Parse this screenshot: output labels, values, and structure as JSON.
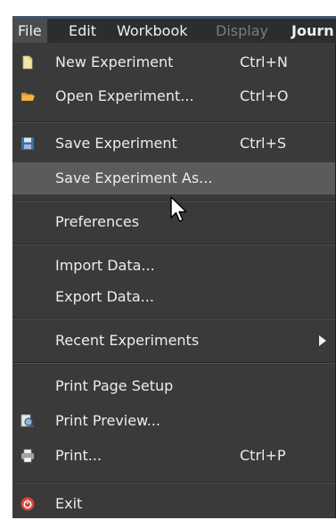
{
  "menubar": {
    "items": [
      {
        "label": "File"
      },
      {
        "label": "Edit"
      },
      {
        "label": "Workbook"
      },
      {
        "label": "Display"
      },
      {
        "label": "Journ"
      }
    ]
  },
  "file_menu": {
    "new": {
      "label": "New Experiment",
      "accel": "Ctrl+N",
      "icon": "document-icon"
    },
    "open": {
      "label": "Open Experiment...",
      "accel": "Ctrl+O",
      "icon": "folder-icon"
    },
    "save": {
      "label": "Save Experiment",
      "accel": "Ctrl+S",
      "icon": "floppy-disk-icon"
    },
    "save_as": {
      "label": "Save Experiment As..."
    },
    "preferences": {
      "label": "Preferences"
    },
    "import": {
      "label": "Import Data..."
    },
    "export": {
      "label": "Export Data..."
    },
    "recent": {
      "label": "Recent Experiments"
    },
    "page_setup": {
      "label": "Print Page Setup"
    },
    "print_preview": {
      "label": "Print Preview...",
      "icon": "print-preview-icon"
    },
    "print": {
      "label": "Print...",
      "accel": "Ctrl+P",
      "icon": "printer-icon"
    },
    "exit": {
      "label": "Exit",
      "icon": "exit-icon"
    }
  },
  "colors": {
    "menu_bg": "#3a3a3a",
    "hover_bg": "#5a5b5c",
    "menubar_bg": "#2b2d2e",
    "text": "#ececec",
    "disabled_text": "#7a7c7e"
  }
}
